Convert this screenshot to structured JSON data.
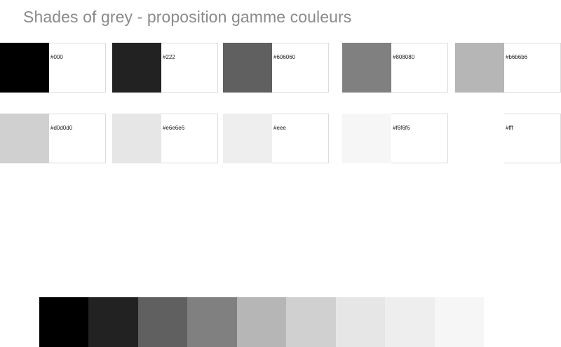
{
  "page": {
    "title": "Shades of grey - proposition gamme couleurs"
  },
  "swatches": [
    {
      "label": "#000",
      "color": "#000000"
    },
    {
      "label": "#222",
      "color": "#222222"
    },
    {
      "label": "#606060",
      "color": "#606060"
    },
    {
      "label": "#808080",
      "color": "#808080"
    },
    {
      "label": "#b6b6b6",
      "color": "#b6b6b6"
    },
    {
      "label": "#d0d0d0",
      "color": "#d0d0d0"
    },
    {
      "label": "#e6e6e6",
      "color": "#e6e6e6"
    },
    {
      "label": "#eee",
      "color": "#eeeeee"
    },
    {
      "label": "#f6f6f6",
      "color": "#f6f6f6"
    },
    {
      "label": "#fff",
      "color": "#ffffff"
    }
  ],
  "strip": {
    "colors": [
      "#000000",
      "#222222",
      "#606060",
      "#808080",
      "#b6b6b6",
      "#d0d0d0",
      "#e6e6e6",
      "#eeeeee",
      "#f6f6f6"
    ]
  }
}
